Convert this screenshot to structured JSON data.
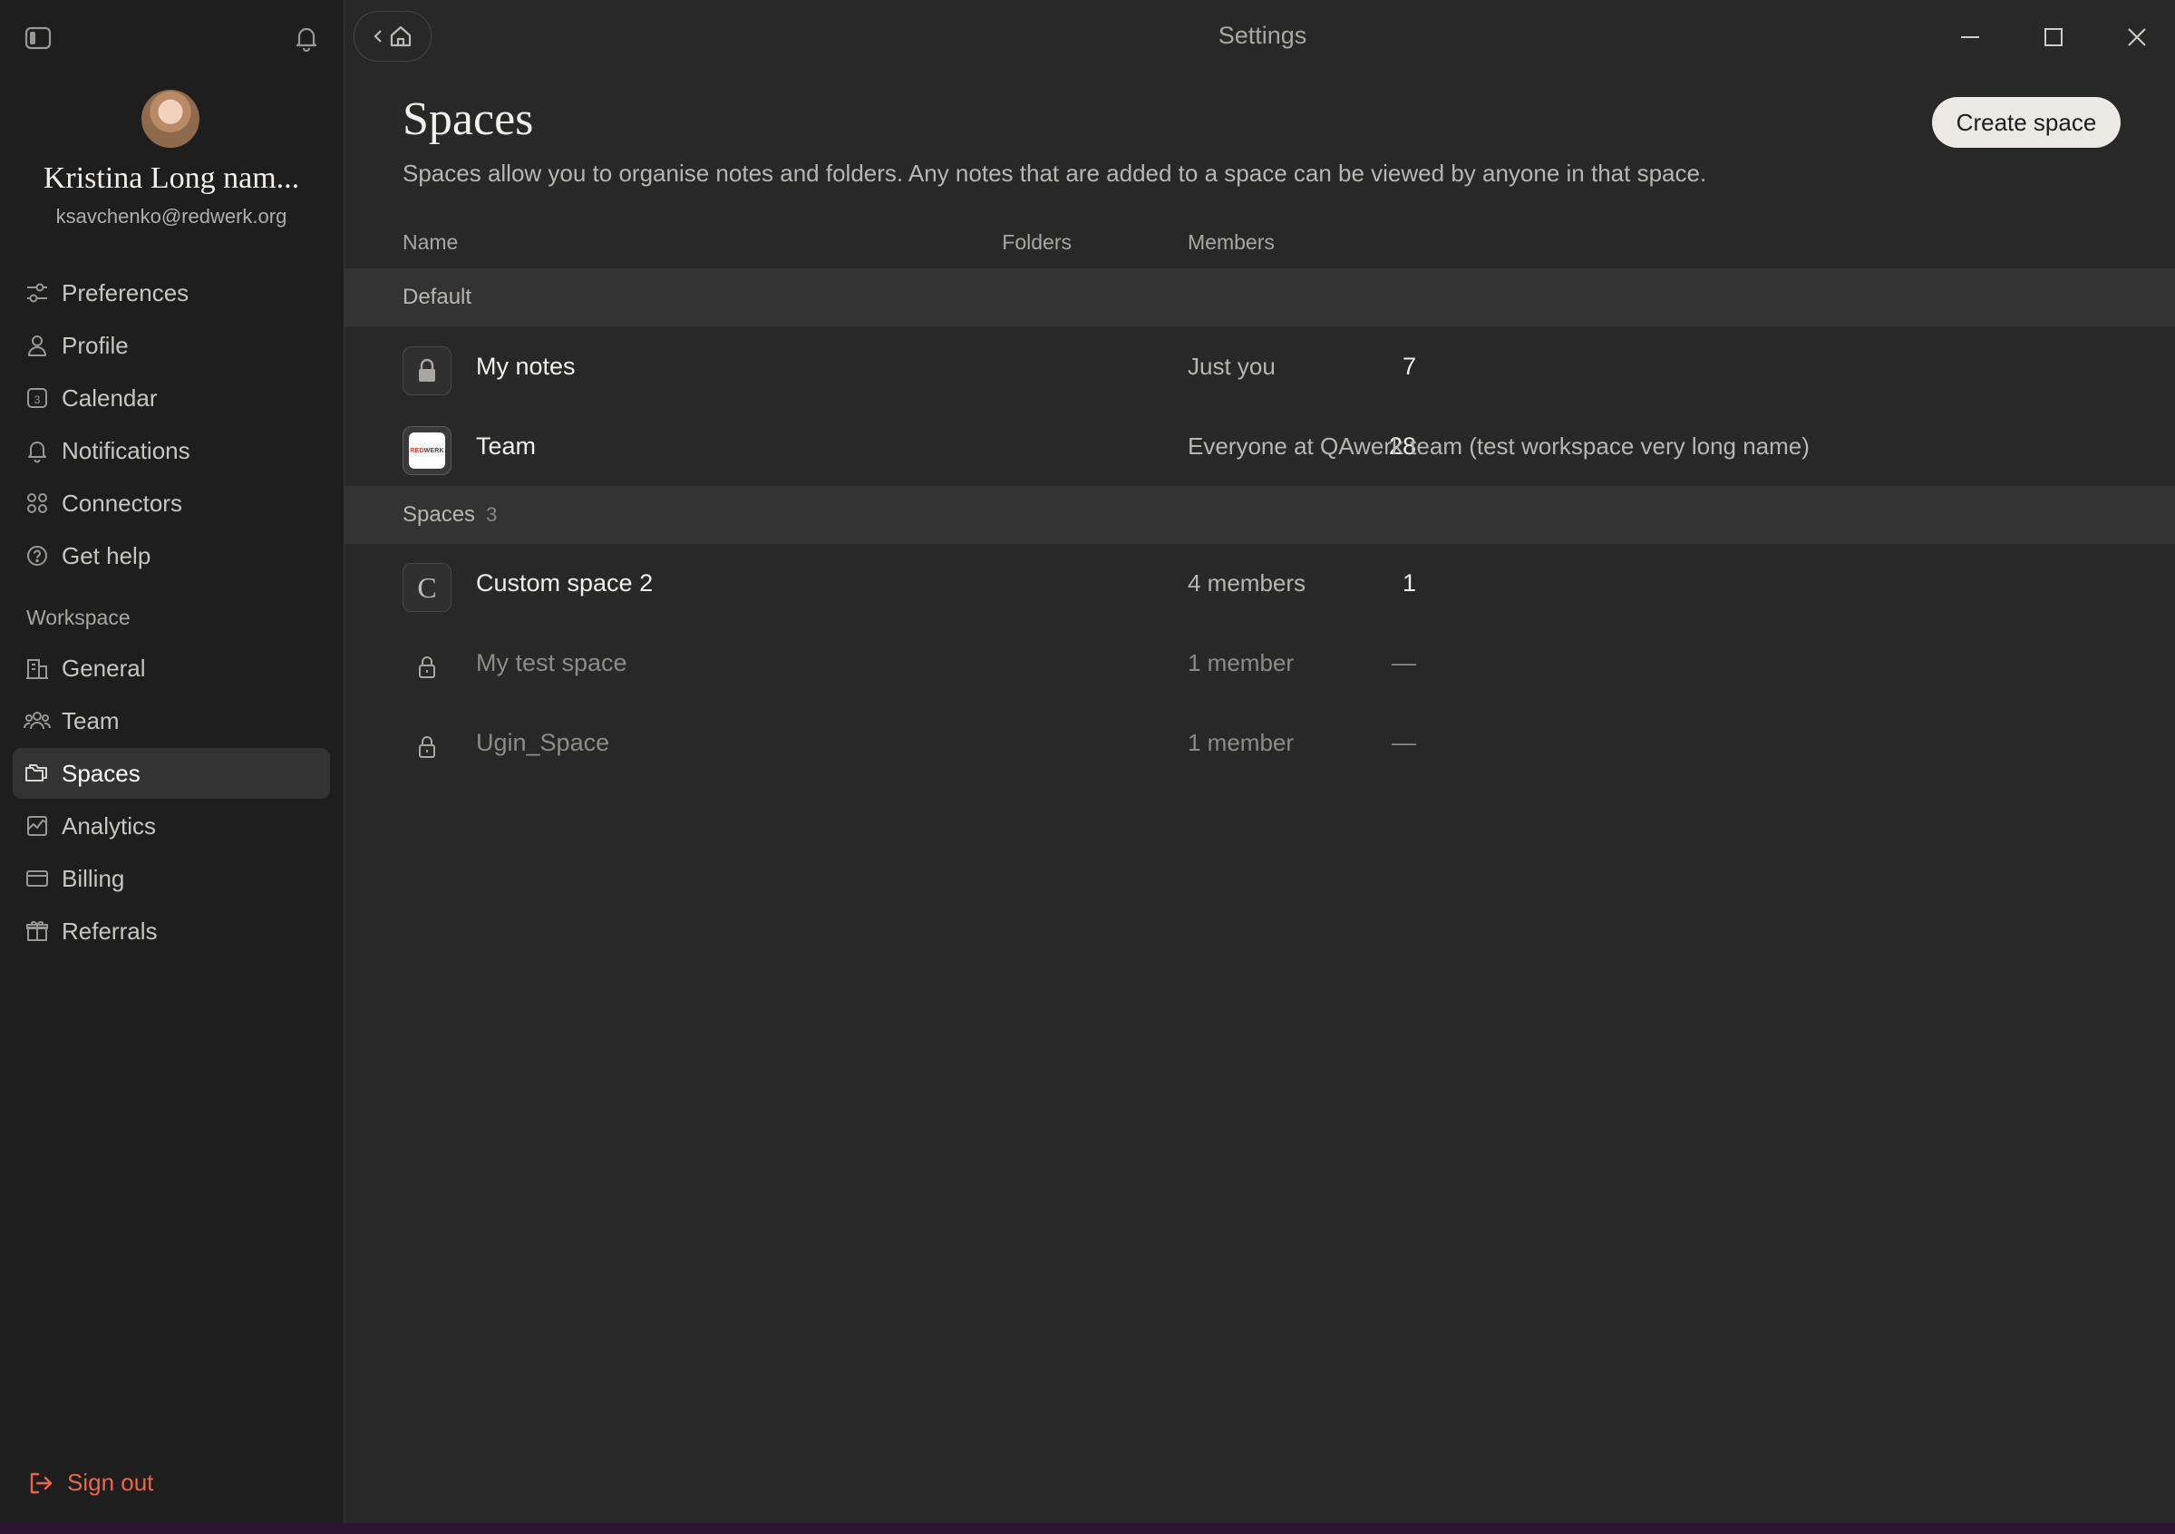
{
  "window": {
    "title": "Settings"
  },
  "user": {
    "name": "Kristina Long nam...",
    "email": "ksavchenko@redwerk.org"
  },
  "nav": {
    "account_items": [
      {
        "label": "Preferences",
        "icon": "sliders-icon"
      },
      {
        "label": "Profile",
        "icon": "person-icon"
      },
      {
        "label": "Calendar",
        "icon": "calendar-icon"
      },
      {
        "label": "Notifications",
        "icon": "bell-icon"
      },
      {
        "label": "Connectors",
        "icon": "connectors-icon"
      },
      {
        "label": "Get help",
        "icon": "help-icon"
      }
    ],
    "workspace_label": "Workspace",
    "workspace_items": [
      {
        "label": "General",
        "icon": "building-icon"
      },
      {
        "label": "Team",
        "icon": "people-icon"
      },
      {
        "label": "Spaces",
        "icon": "folders-icon",
        "active": true
      },
      {
        "label": "Analytics",
        "icon": "chart-icon"
      },
      {
        "label": "Billing",
        "icon": "card-icon"
      },
      {
        "label": "Referrals",
        "icon": "gift-icon"
      }
    ],
    "signout_label": "Sign out",
    "calendar_day": "3"
  },
  "page": {
    "title": "Spaces",
    "description": "Spaces allow you to organise notes and folders. Any notes that are added to a space can be viewed by anyone in that space.",
    "create_button": "Create space"
  },
  "table": {
    "headers": {
      "name": "Name",
      "folders": "Folders",
      "members": "Members"
    },
    "default_group": {
      "label": "Default",
      "rows": [
        {
          "name": "My notes",
          "folders": "7",
          "members": "Just you",
          "icon": "lock-icon"
        },
        {
          "name": "Team",
          "folders": "28",
          "members": "Everyone at QAwerk team (test workspace very long name)",
          "icon": "team-logo"
        }
      ]
    },
    "spaces_group": {
      "label": "Spaces",
      "count": "3",
      "rows": [
        {
          "name": "Custom space 2",
          "folders": "1",
          "members": "4 members",
          "icon_letter": "C"
        },
        {
          "name": "My test space",
          "folders": "—",
          "members": "1 member",
          "icon": "lock-open-icon"
        },
        {
          "name": "Ugin_Space",
          "folders": "—",
          "members": "1 member",
          "icon": "lock-open-icon"
        }
      ]
    }
  },
  "team_logo_text": {
    "red": "RED",
    "dark": "WERK"
  },
  "colors": {
    "background": "#282828",
    "sidebar": "#1e1e1e",
    "group_row": "#333333",
    "signout": "#e8664a",
    "button_bg": "#ece9e4"
  }
}
